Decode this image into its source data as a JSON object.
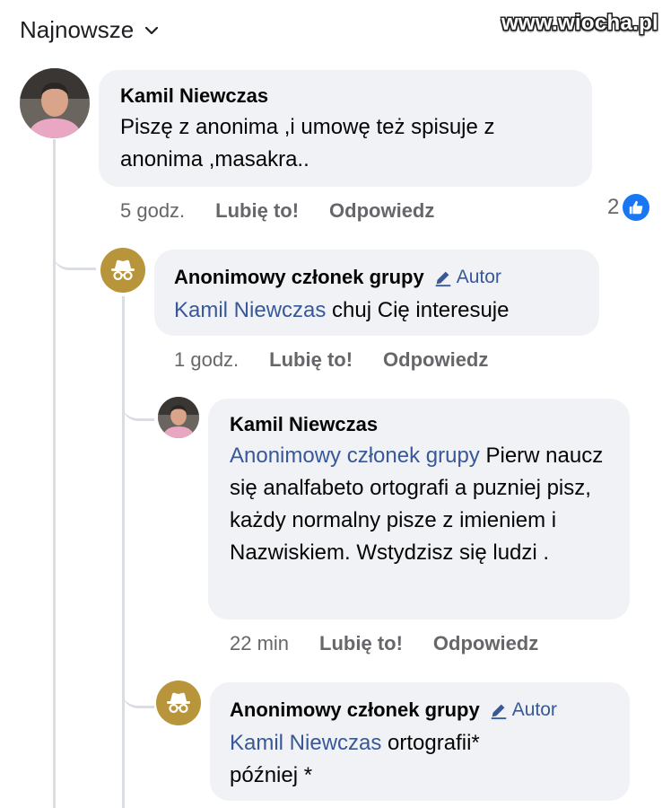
{
  "sort": {
    "label": "Najnowsze"
  },
  "watermark": "www.wiocha.pl",
  "comments": [
    {
      "author": "Kamil Niewczas",
      "text": "Piszę z anonima ,i umowę też spisuje z anonima ,masakra..",
      "time": "5 godz.",
      "like_label": "Lubię to!",
      "reply_label": "Odpowiedz",
      "reactions": "2"
    },
    {
      "author": "Anonimowy członek grupy",
      "badge": "Autor",
      "mention": "Kamil Niewczas",
      "text": " chuj Cię interesuje",
      "time": "1 godz.",
      "like_label": "Lubię to!",
      "reply_label": "Odpowiedz"
    },
    {
      "author": "Kamil Niewczas",
      "mention": "Anonimowy członek grupy",
      "text": " Pierw naucz się analfabeto ortografi a puzniej  pisz, każdy normalny pisze z imieniem i Nazwiskiem. Wstydzisz się ludzi .",
      "time": "22 min",
      "like_label": "Lubię to!",
      "reply_label": "Odpowiedz"
    },
    {
      "author": "Anonimowy członek grupy",
      "badge": "Autor",
      "mention": "Kamil Niewczas",
      "text": " ortografii* później *"
    }
  ],
  "colors": {
    "mention": "#385898",
    "bubble": "#f0f2f5",
    "anon_avatar": "#b8953a",
    "like": "#1877f2"
  }
}
